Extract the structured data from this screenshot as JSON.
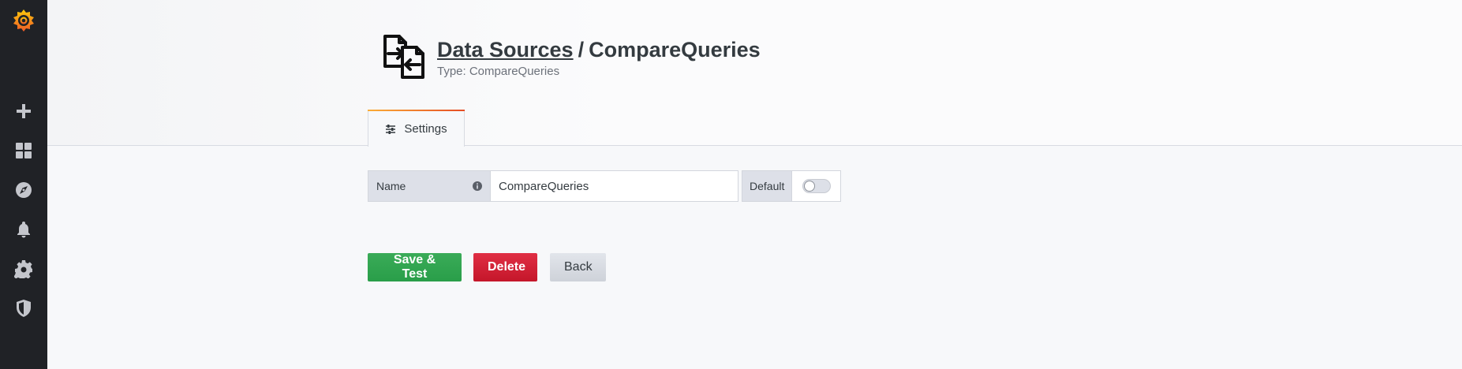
{
  "sidebar": {
    "items": [
      {
        "icon": "plus-icon",
        "name": "create"
      },
      {
        "icon": "apps-icon",
        "name": "dashboards"
      },
      {
        "icon": "compass-icon",
        "name": "explore"
      },
      {
        "icon": "bell-icon",
        "name": "alerting"
      },
      {
        "icon": "cog-icon",
        "name": "configuration"
      },
      {
        "icon": "shield-icon",
        "name": "server-admin"
      }
    ]
  },
  "header": {
    "breadcrumb_link": "Data Sources",
    "separator": "/",
    "title": "CompareQueries",
    "subtitle": "Type: CompareQueries"
  },
  "tabs": [
    {
      "label": "Settings",
      "icon": "sliders-icon",
      "active": true
    }
  ],
  "form": {
    "name_label": "Name",
    "name_value": "CompareQueries",
    "default_label": "Default",
    "default_enabled": false
  },
  "buttons": {
    "save": "Save & Test",
    "delete": "Delete",
    "back": "Back"
  },
  "colors": {
    "sidebar": "#202226",
    "accent": "#eb7b18",
    "save": "#299e49",
    "delete": "#c4162a"
  }
}
